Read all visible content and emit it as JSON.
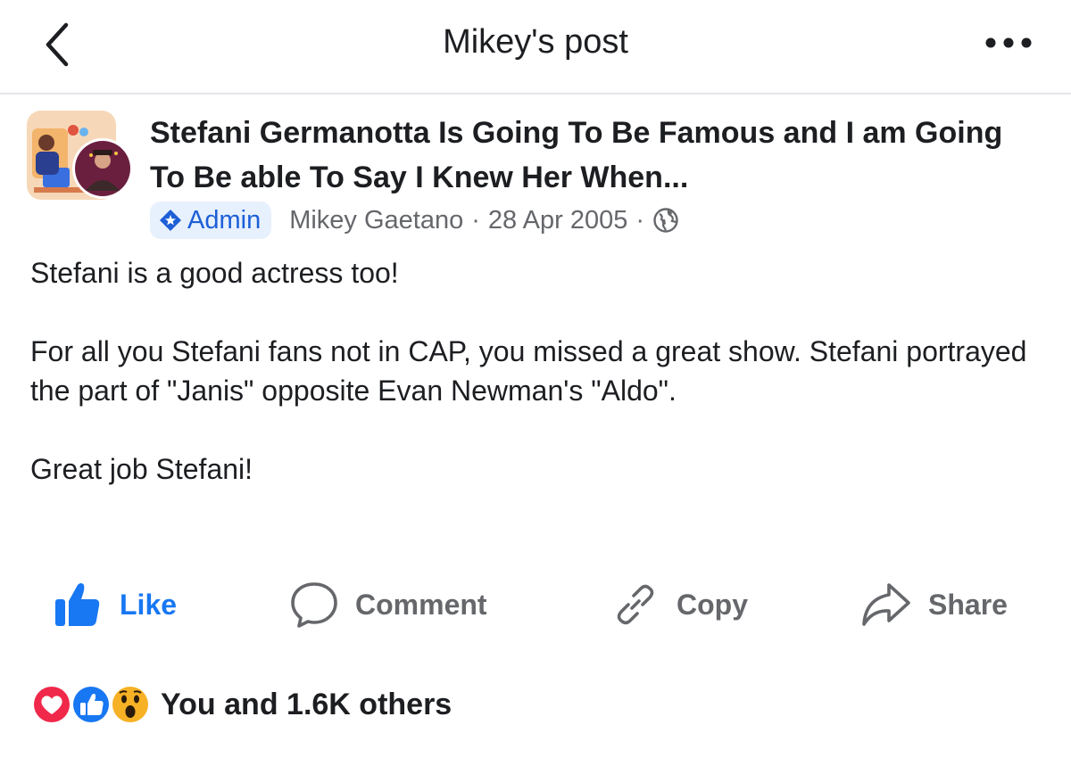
{
  "header": {
    "title": "Mikey's post",
    "back_icon": "chevron-left-icon",
    "more_icon": "more-horizontal-icon"
  },
  "post": {
    "group_name": "Stefani Germanotta Is Going To Be Famous and I am Going To Be able To Say I Knew Her When...",
    "role_badge": "Admin",
    "author": "Mikey Gaetano",
    "separator": "·",
    "date": "28 Apr 2005",
    "audience_icon": "globe-icon",
    "body": {
      "line1": "Stefani is a good actress too!",
      "line2": "For all you Stefani fans not in CAP, you missed a great show. Stefani portrayed the part of \"Janis\" opposite Evan Newman's \"Aldo\".",
      "line3": "Great job Stefani!"
    }
  },
  "actions": {
    "like": "Like",
    "comment": "Comment",
    "copy": "Copy",
    "share": "Share"
  },
  "reactions": {
    "summary": "You and 1.6K others",
    "icons": [
      "love-reaction-icon",
      "like-reaction-icon",
      "wow-reaction-icon"
    ]
  },
  "colors": {
    "accent": "#1877f2",
    "secondary_text": "#65676b",
    "love": "#f0284a",
    "wow": "#f7b125"
  }
}
